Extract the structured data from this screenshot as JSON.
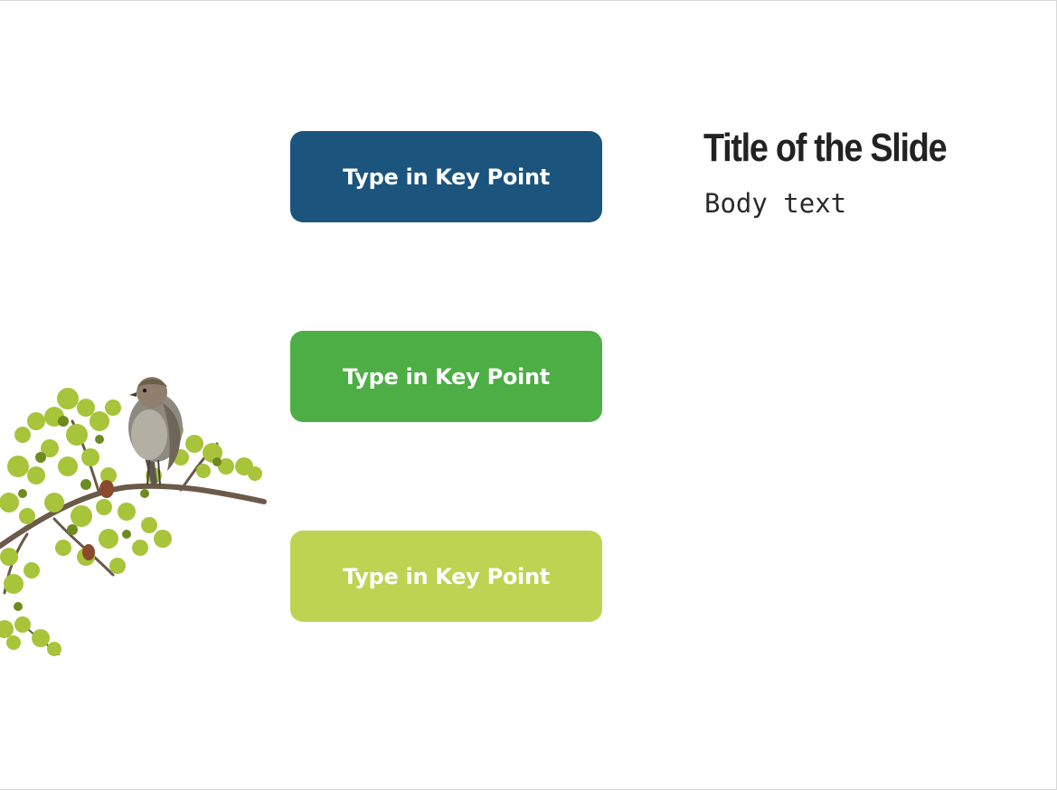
{
  "slide": {
    "title": "Title of the Slide",
    "body_text": "Body text",
    "key_points": [
      {
        "label": "Type in Key Point",
        "color": "#1b557e"
      },
      {
        "label": "Type in Key Point",
        "color": "#4dae45"
      },
      {
        "label": "Type in Key Point",
        "color": "#bfd352"
      }
    ],
    "image": "bird-on-branch-image",
    "colors": {
      "background": "#ffffff",
      "title_text": "#222222",
      "body_text": "#2a2a2a",
      "leaf_green": "#a7c43a",
      "leaf_dark": "#6d8b1f",
      "branch": "#6b5a4a",
      "bird_body": "#8d8a80"
    }
  }
}
